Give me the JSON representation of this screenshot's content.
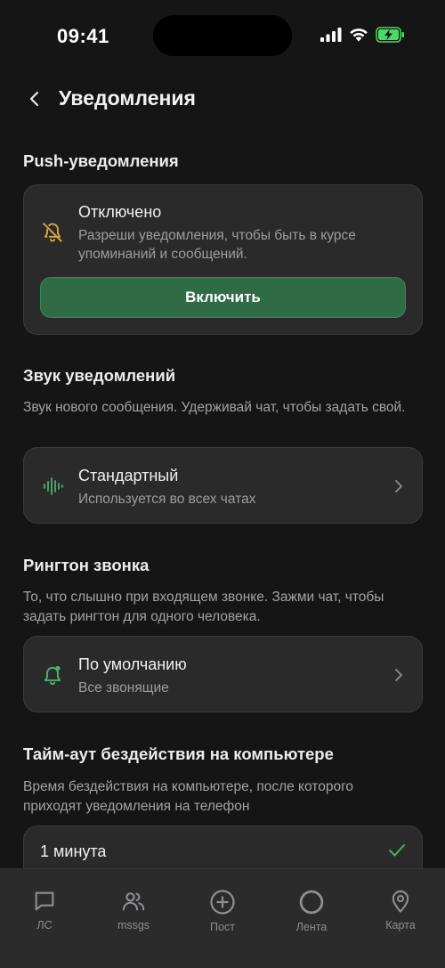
{
  "status_bar": {
    "time": "09:41"
  },
  "header": {
    "title": "Уведомления"
  },
  "push": {
    "section_title": "Push-уведомления",
    "card_title": "Отключено",
    "card_desc": "Разреши уведомления, чтобы быть в курсе упоминаний и сообщений.",
    "button_label": "Включить",
    "icon": "bell-off-icon"
  },
  "sound": {
    "section_title": "Звук уведомлений",
    "section_desc": "Звук нового сообщения. Удерживай чат, чтобы задать свой.",
    "card_title": "Стандартный",
    "card_sub": "Используется во всех чатах",
    "icon": "waveform-icon"
  },
  "ringtone": {
    "section_title": "Рингтон звонка",
    "section_desc": "То, что слышно при входящем звонке. Зажми чат, чтобы задать рингтон для одного человека.",
    "card_title": "По умолчанию",
    "card_sub": "Все звонящие",
    "icon": "bell-icon"
  },
  "timeout": {
    "section_title": "Тайм-аут бездействия на компьютере",
    "section_desc": "Время бездействия на компьютере, после которого приходят уведомления на телефон",
    "selected_option": "1 минута"
  },
  "bottom_nav": {
    "items": [
      {
        "label": "ЛС",
        "icon": "chat-bubble-icon"
      },
      {
        "label": "mssgs",
        "icon": "people-icon"
      },
      {
        "label": "Пост",
        "icon": "plus-circle-icon"
      },
      {
        "label": "Лента",
        "icon": "circle-icon"
      },
      {
        "label": "Карта",
        "icon": "map-pin-icon"
      }
    ]
  },
  "colors": {
    "background": "#151516",
    "card": "#2a2a2b",
    "accent_green": "#2f6b45",
    "warning_icon": "#d9a23a",
    "green_icon": "#4caf68"
  }
}
